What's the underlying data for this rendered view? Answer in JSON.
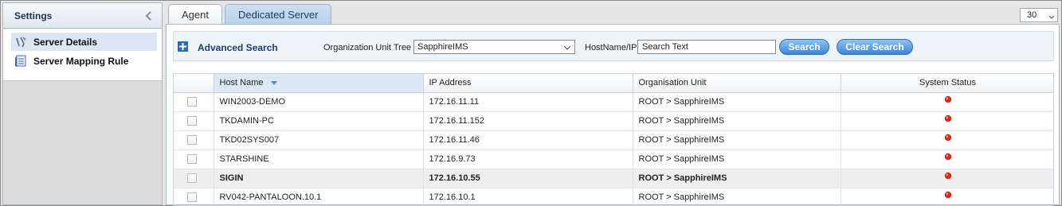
{
  "sidebar": {
    "title": "Settings",
    "items": [
      {
        "label": "Server Details",
        "icon": "server-details-icon"
      },
      {
        "label": "Server Mapping Rule",
        "icon": "mapping-rule-icon"
      }
    ]
  },
  "tabs": [
    {
      "label": "Agent"
    },
    {
      "label": "Dedicated Server"
    }
  ],
  "page_size": "30",
  "search": {
    "advanced_label": "Advanced Search",
    "org_label": "Organization Unit Tree",
    "org_value": "SapphireIMS",
    "host_label": "HostName/IP",
    "host_value": "Search Text",
    "search_button": "Search",
    "clear_button": "Clear Search"
  },
  "table": {
    "columns": [
      "Host Name",
      "IP Address",
      "Organisation Unit",
      "System Status"
    ],
    "rows": [
      {
        "host": "WIN2003-DEMO",
        "ip": "172.16.11.11",
        "ou": "ROOT > SapphireIMS"
      },
      {
        "host": "TKDAMIN-PC",
        "ip": "172.16.11.152",
        "ou": "ROOT > SapphireIMS"
      },
      {
        "host": "TKD02SYS007",
        "ip": "172.16.11.46",
        "ou": "ROOT > SapphireIMS"
      },
      {
        "host": "STARSHINE",
        "ip": "172.16.9.73",
        "ou": "ROOT > SapphireIMS"
      },
      {
        "host": "SIGIN",
        "ip": "172.16.10.55",
        "ou": "ROOT > SapphireIMS"
      },
      {
        "host": "RV042-PANTALOON.10.1",
        "ip": "172.16.10.1",
        "ou": "ROOT > SapphireIMS"
      }
    ]
  },
  "colors": {
    "accent": "#3b86d6",
    "status_red": "#d42a1a",
    "link": "#1d3e73"
  }
}
